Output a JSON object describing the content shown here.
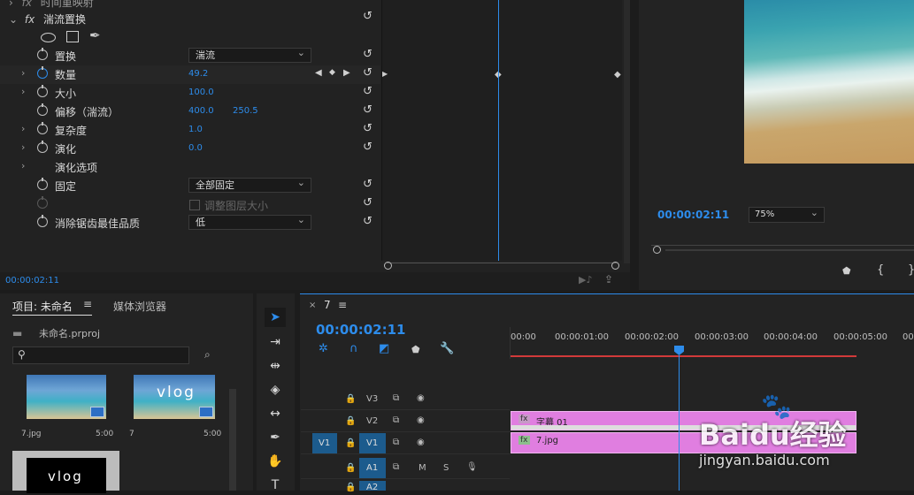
{
  "effect_controls": {
    "header_row": "时间重映射",
    "effect_name": "湍流置换",
    "props": [
      {
        "label": "置换",
        "dropdown": "湍流"
      },
      {
        "label": "数量",
        "value": "49.2"
      },
      {
        "label": "大小",
        "value": "100.0"
      },
      {
        "label": "偏移（湍流）",
        "value": "400.0",
        "value2": "250.5"
      },
      {
        "label": "复杂度",
        "value": "1.0"
      },
      {
        "label": "演化",
        "value": "0.0"
      },
      {
        "label": "演化选项"
      },
      {
        "label": "固定",
        "dropdown": "全部固定"
      },
      {
        "label": "",
        "checkbox": "调整图层大小"
      },
      {
        "label": "消除锯齿最佳品质",
        "dropdown": "低"
      }
    ],
    "timecode": "00:00:02:11"
  },
  "program_monitor": {
    "timecode": "00:00:02:11",
    "zoom": "75%"
  },
  "project": {
    "tab_project": "项目: 未命名",
    "tab_media": "媒体浏览器",
    "filename": "未命名.prproj",
    "items": [
      {
        "name": "7.jpg",
        "duration": "5:00"
      },
      {
        "name": "7",
        "duration": "5:00"
      }
    ],
    "thumb_text": "vlog"
  },
  "timeline": {
    "tab": "7",
    "timecode": "00:00:02:11",
    "ruler": [
      "00:00",
      "00:00:01:00",
      "00:00:02:00",
      "00:00:03:00",
      "00:00:04:00",
      "00:00:05:00",
      "00"
    ],
    "tracks": [
      {
        "src": "",
        "name": "V3"
      },
      {
        "src": "",
        "name": "V2"
      },
      {
        "src": "V1",
        "name": "V1"
      },
      {
        "src": "",
        "name": "A1"
      },
      {
        "src": "",
        "name": "A2"
      }
    ],
    "clip_v2": "字幕 01",
    "clip_v1": "7.jpg"
  },
  "watermark": {
    "brand": "Baidu经验",
    "url": "jingyan.baidu.com"
  },
  "colors": {
    "accent": "#2d8ceb",
    "clip": "#e07ee0",
    "playhead": "#2d8ceb"
  }
}
